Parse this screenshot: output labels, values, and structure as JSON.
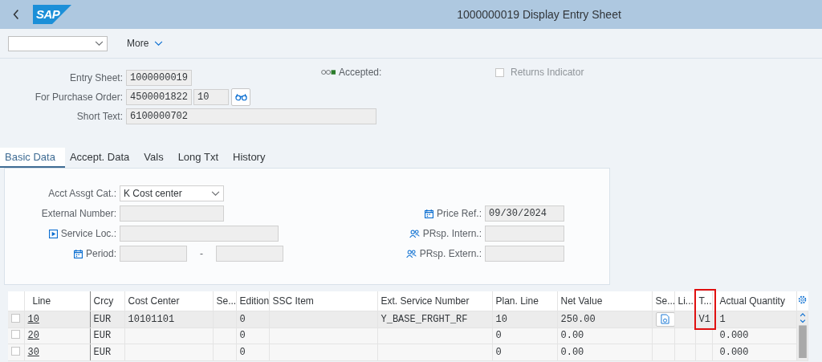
{
  "header": {
    "logo": "SAP",
    "title": "1000000019 Display Entry Sheet"
  },
  "toolbar": {
    "more": "More"
  },
  "entry": {
    "entry_sheet": {
      "label": "Entry Sheet:",
      "value": "1000000019"
    },
    "purchase_order": {
      "label": "For Purchase Order:",
      "value": "4500001822",
      "item": "10"
    },
    "short_text": {
      "label": "Short Text:",
      "value": "6100000702"
    },
    "accepted": {
      "label": "Accepted:"
    },
    "returns_indicator": {
      "label": "Returns Indicator",
      "checked": false
    }
  },
  "tabs": [
    {
      "label": "Basic Data",
      "selected": true
    },
    {
      "label": "Accept. Data",
      "selected": false
    },
    {
      "label": "Vals",
      "selected": false
    },
    {
      "label": "Long Txt",
      "selected": false
    },
    {
      "label": "History",
      "selected": false
    }
  ],
  "basic_data": {
    "left": [
      {
        "kind": "dropdown",
        "label": "Acct Assgt Cat.:",
        "value": "K Cost center"
      },
      {
        "kind": "text",
        "label": "External Number:"
      },
      {
        "kind": "location",
        "label": "Service Loc.:"
      },
      {
        "kind": "period",
        "label": "Period:",
        "separator": "-"
      }
    ],
    "right": [
      {
        "kind": "date",
        "label": "Price Ref.:",
        "value": "09/30/2024"
      },
      {
        "kind": "partner",
        "label": "PRsp. Intern.:"
      },
      {
        "kind": "partner",
        "label": "PRsp. Extern.:"
      }
    ]
  },
  "table": {
    "columns": [
      "Line",
      "Crcy",
      "Cost Center",
      "Se...",
      "Edition",
      "SSC Item",
      "Ext. Service Number",
      "Plan. Line",
      "Net Value",
      "Se...",
      "Li...",
      "T...",
      "Actual Quantity"
    ],
    "rows": [
      {
        "selected": false,
        "service_button": true,
        "cells": [
          "10",
          "EUR",
          "10101101",
          "",
          "0",
          "",
          "Y_BASE_FRGHT_RF",
          "10",
          "250.00",
          "",
          "",
          "V1",
          "1"
        ]
      },
      {
        "selected": false,
        "service_button": false,
        "cells": [
          "20",
          "EUR",
          "",
          "",
          "0",
          "",
          "",
          "0",
          "0.00",
          "",
          "",
          "",
          "0.000"
        ]
      },
      {
        "selected": false,
        "service_button": false,
        "cells": [
          "30",
          "EUR",
          "",
          "",
          "0",
          "",
          "",
          "0",
          "0.00",
          "",
          "",
          "",
          "0.000"
        ]
      }
    ]
  }
}
